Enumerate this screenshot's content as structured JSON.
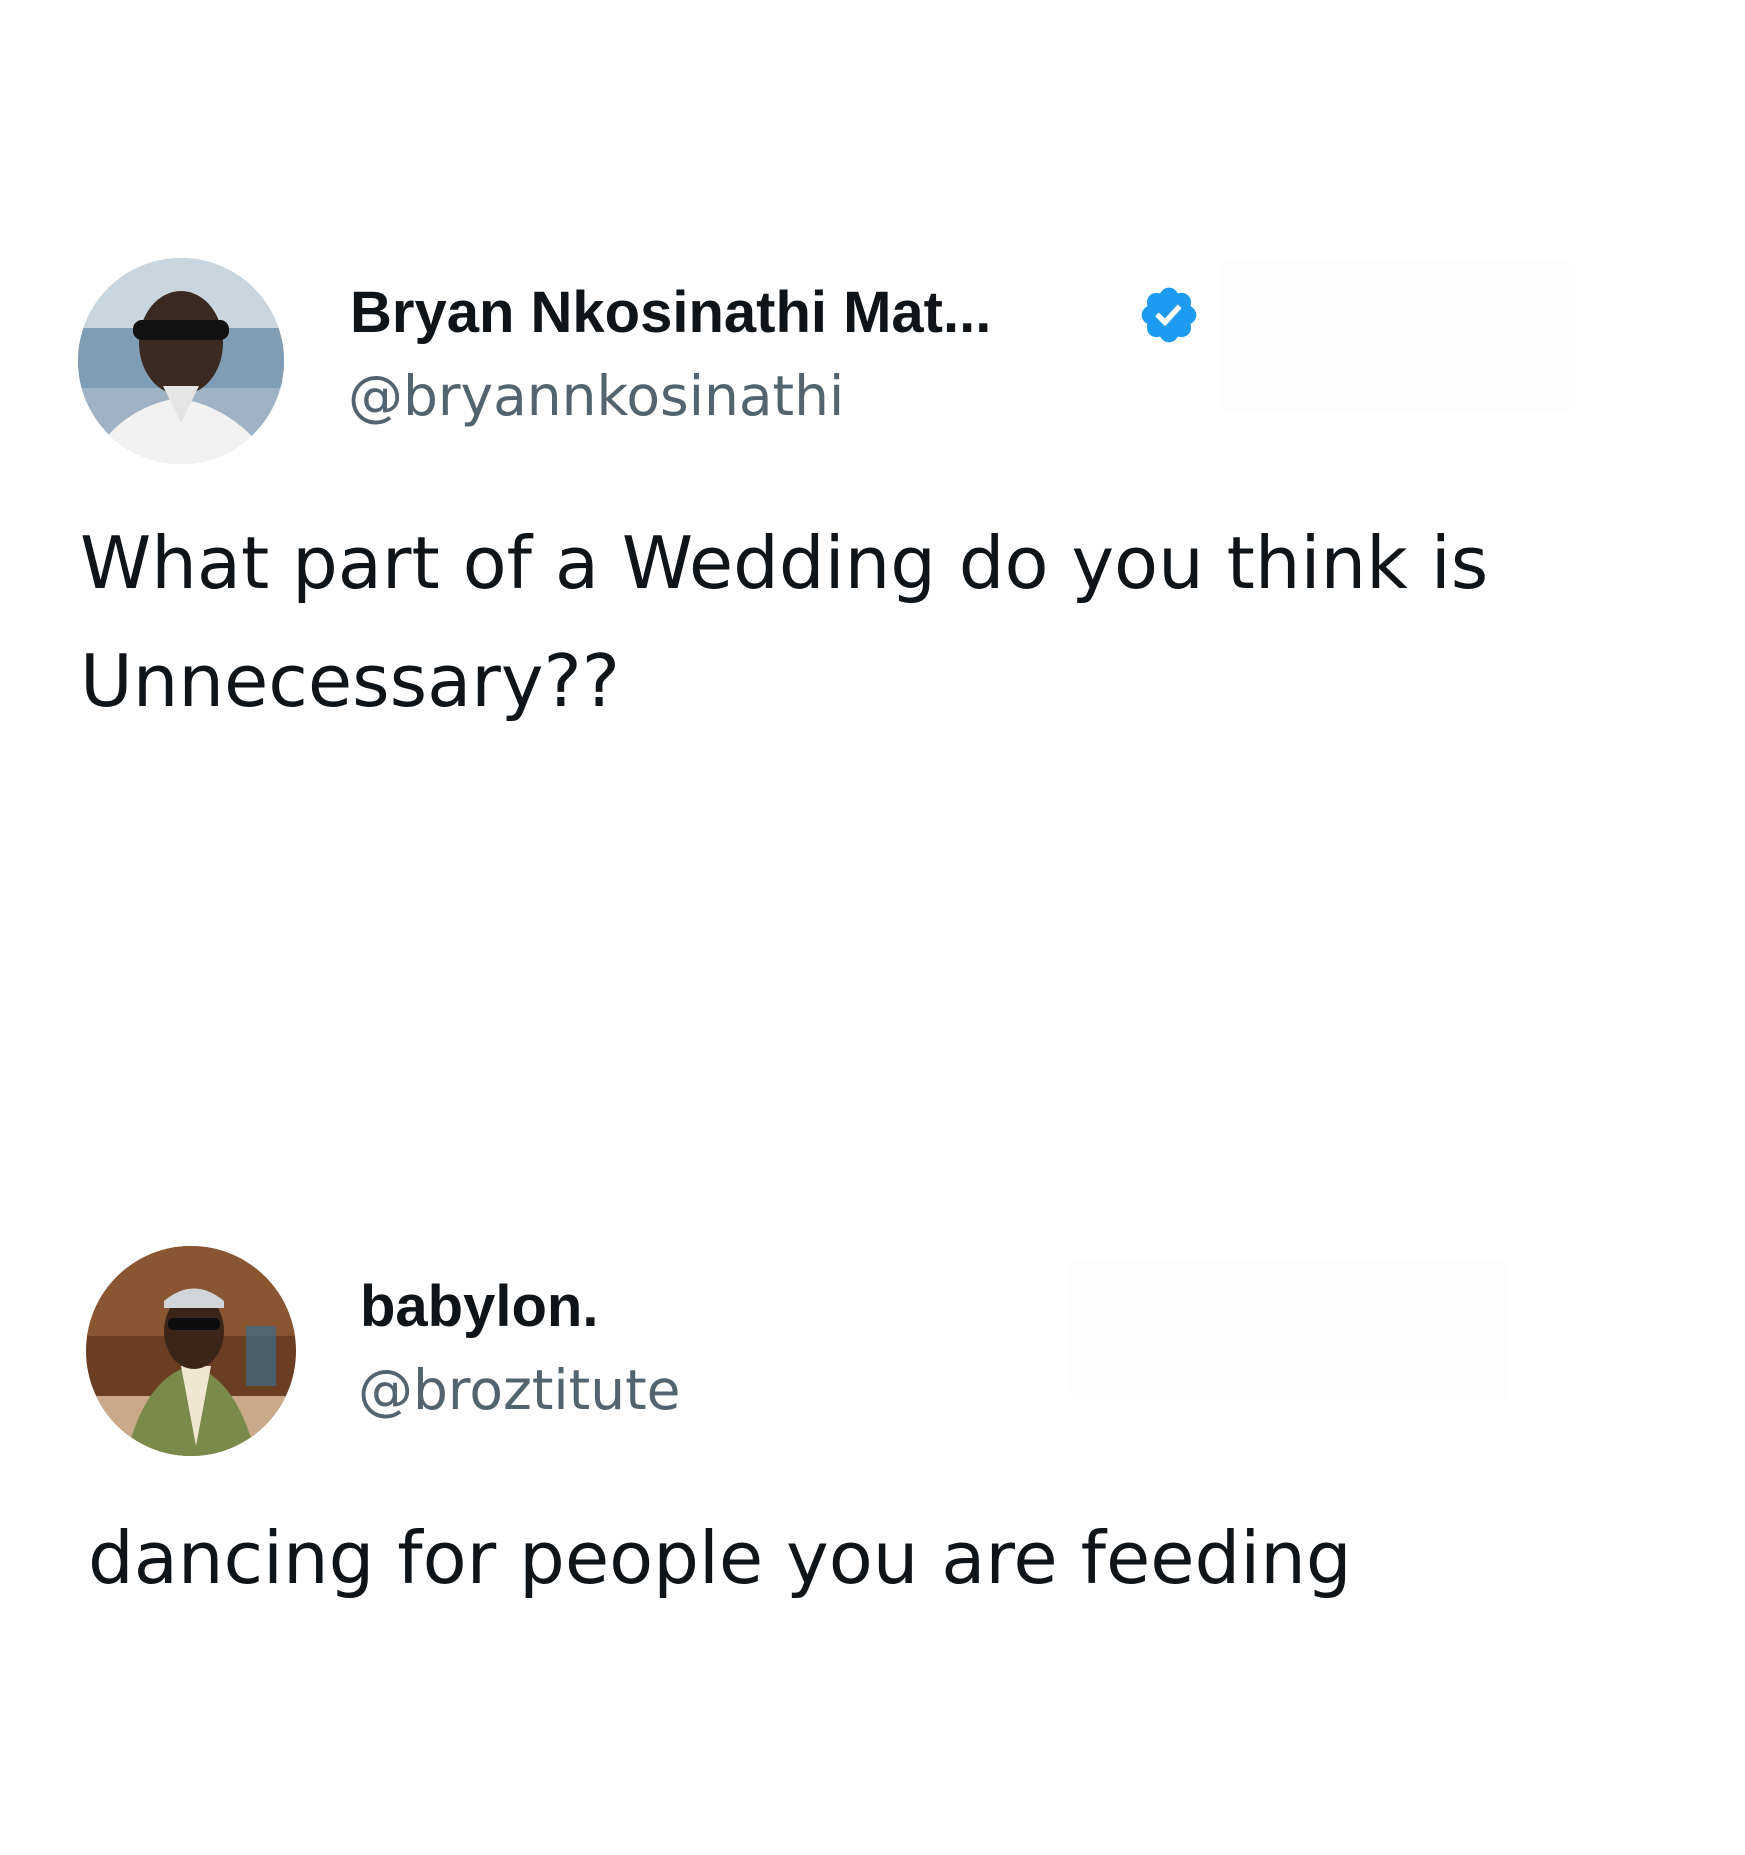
{
  "tweets": [
    {
      "display_name": "Bryan Nkosinathi Mat...",
      "verified": true,
      "handle": "@bryannkosinathi",
      "text": "What part of a Wedding do you think is Unnecessary??"
    },
    {
      "display_name": "babylon.",
      "verified": false,
      "handle": "@broztitute",
      "text": "dancing for people you are feeding"
    }
  ],
  "colors": {
    "text_primary": "#0f1419",
    "text_secondary": "#536471",
    "verified_badge": "#1d9bf0",
    "background": "#ffffff"
  },
  "icons": {
    "verified": "verified-badge-icon"
  }
}
